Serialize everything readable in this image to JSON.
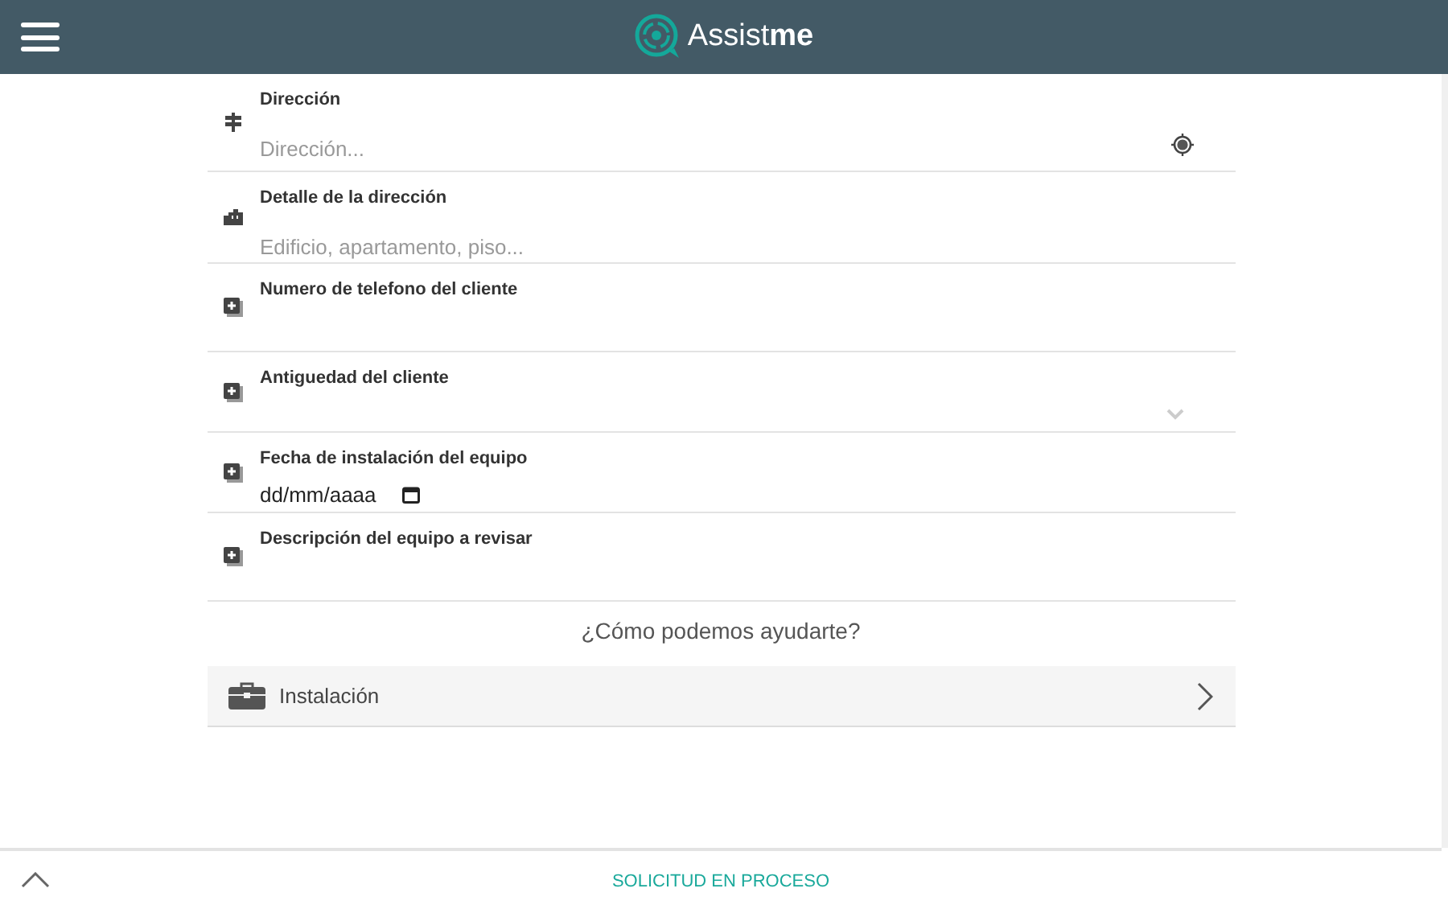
{
  "header": {
    "logo_text": "Assist**me**"
  },
  "fields": [
    {
      "kind": "address",
      "label": "Dirección",
      "placeholder": "Dirección..."
    },
    {
      "kind": "detail",
      "label": "Detalle de la dirección",
      "placeholder": "Edificio, apartamento, piso..."
    },
    {
      "kind": "text",
      "label": "Numero de telefono del cliente"
    },
    {
      "kind": "select",
      "label": "Antiguedad del cliente"
    },
    {
      "kind": "date",
      "label": "Fecha de instalación del equipo",
      "placeholder": "dd/mm/aaaa"
    },
    {
      "kind": "text",
      "label": "Descripción del equipo a revisar"
    }
  ],
  "help": {
    "title": "¿Cómo podemos ayudarte?",
    "options": [
      {
        "label": "Instalación"
      }
    ]
  },
  "footer": {
    "status": "SOLICITUD EN PROCESO"
  }
}
